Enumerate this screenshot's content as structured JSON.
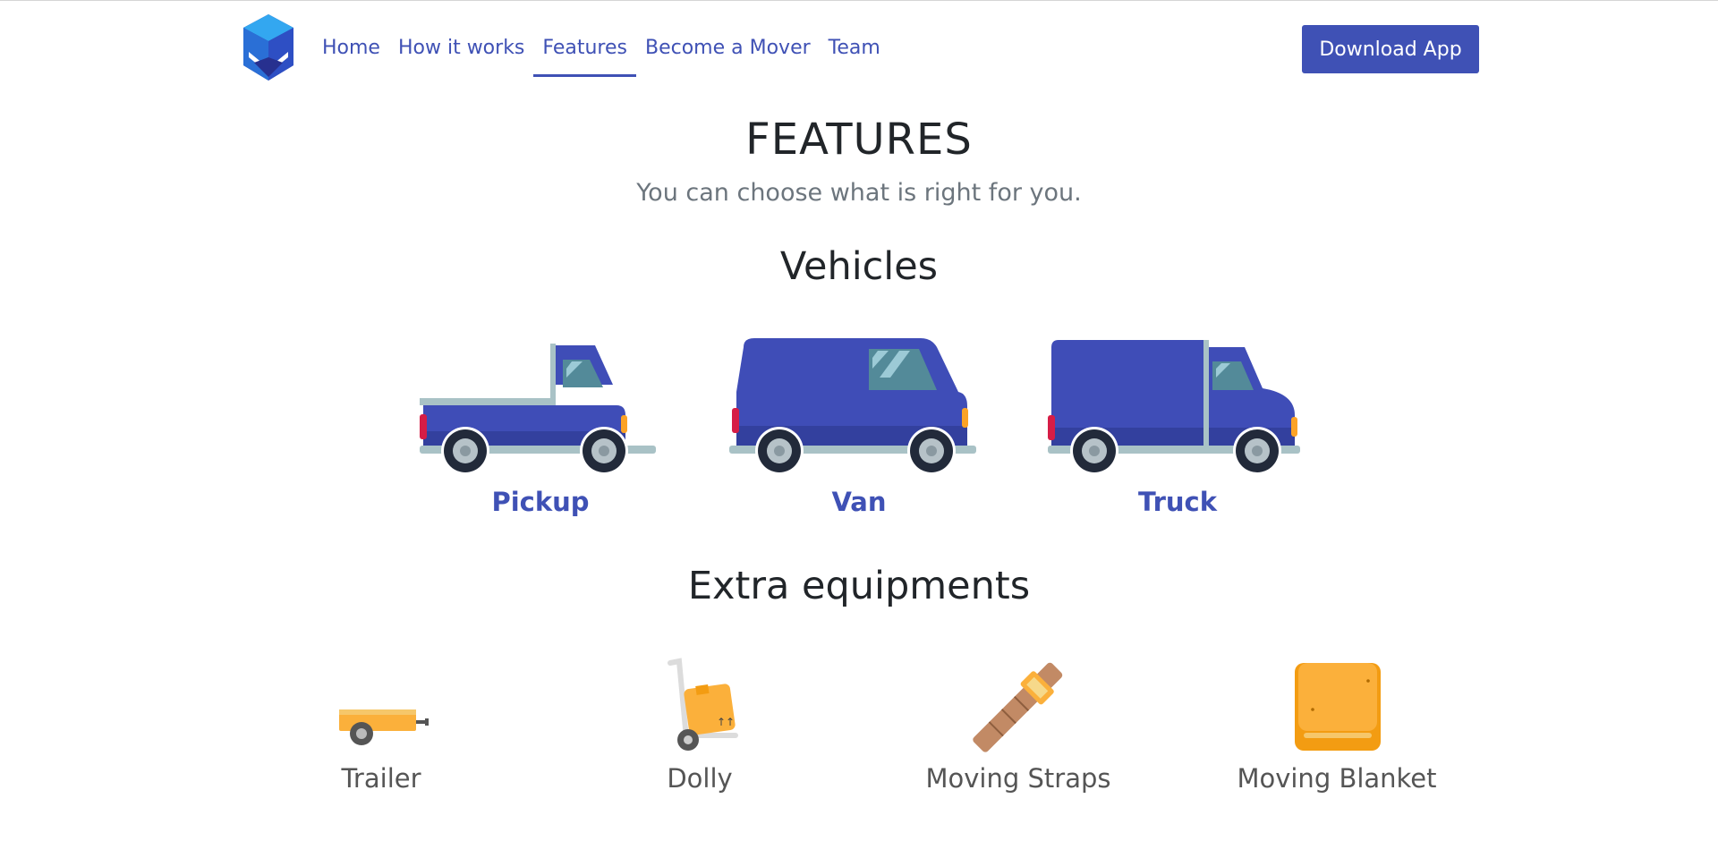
{
  "nav": {
    "logo": "mover-logo-icon",
    "links": [
      {
        "label": "Home"
      },
      {
        "label": "How it works"
      },
      {
        "label": "Features",
        "active": true
      },
      {
        "label": "Become a Mover"
      },
      {
        "label": "Team"
      }
    ],
    "download_label": "Download App"
  },
  "header": {
    "title": "FEATURES",
    "subtitle": "You can choose what is right for you."
  },
  "vehicles": {
    "title": "Vehicles",
    "items": [
      {
        "label": "Pickup",
        "icon": "pickup-truck-icon"
      },
      {
        "label": "Van",
        "icon": "van-icon"
      },
      {
        "label": "Truck",
        "icon": "box-truck-icon"
      }
    ]
  },
  "equipment": {
    "title": "Extra equipments",
    "items": [
      {
        "label": "Trailer",
        "icon": "trailer-icon"
      },
      {
        "label": "Dolly",
        "icon": "dolly-icon"
      },
      {
        "label": "Moving Straps",
        "icon": "strap-icon"
      },
      {
        "label": "Moving Blanket",
        "icon": "blanket-icon"
      }
    ]
  },
  "colors": {
    "brand": "#3f51b5",
    "accent_yellow": "#fbb03b"
  }
}
